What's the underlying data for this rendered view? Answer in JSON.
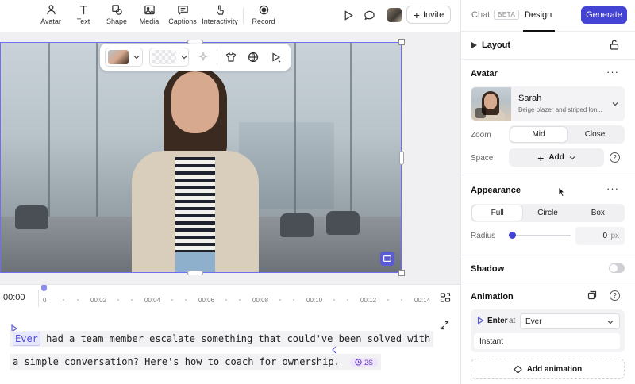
{
  "toolbar": {
    "tools": [
      {
        "label": "Avatar",
        "icon": "person-icon"
      },
      {
        "label": "Text",
        "icon": "text-icon"
      },
      {
        "label": "Shape",
        "icon": "shape-icon"
      },
      {
        "label": "Media",
        "icon": "image-icon"
      },
      {
        "label": "Captions",
        "icon": "captions-icon"
      },
      {
        "label": "Interactivity",
        "icon": "interactivity-icon"
      },
      {
        "label": "Record",
        "icon": "record-icon"
      }
    ],
    "invite_label": "Invite"
  },
  "timeline": {
    "current_time": "00:00",
    "ticks": [
      "0",
      "00:02",
      "00:04",
      "00:06",
      "00:08",
      "00:10",
      "00:12",
      "00:14"
    ]
  },
  "script": {
    "highlight_word": "Ever",
    "line1_rest": "had a team member escalate something that could've been solved with",
    "line2": "a simple conversation? Here's how to coach for ownership.",
    "duration_pill": "2S"
  },
  "panel": {
    "tabs": {
      "chat": "Chat",
      "beta": "BETA",
      "design": "Design"
    },
    "generate_label": "Generate",
    "layout": {
      "title": "Layout"
    },
    "avatar": {
      "title": "Avatar",
      "name": "Sarah",
      "description": "Beige blazer and striped lon...",
      "zoom_label": "Zoom",
      "zoom_options": [
        "Mid",
        "Close"
      ],
      "zoom_selected": "Mid",
      "space_label": "Space",
      "add_label": "Add"
    },
    "appearance": {
      "title": "Appearance",
      "options": [
        "Full",
        "Circle",
        "Box"
      ],
      "selected": "Full",
      "radius_label": "Radius",
      "radius_value": "0",
      "radius_unit": "px"
    },
    "shadow": {
      "title": "Shadow",
      "enabled": false
    },
    "animation": {
      "title": "Animation",
      "enter_label": "Enter",
      "at_label": "at",
      "at_value": "Ever",
      "type": "Instant",
      "add_label": "Add animation"
    }
  },
  "colors": {
    "accent": "#4343d4",
    "selection": "#6f6ff0"
  }
}
